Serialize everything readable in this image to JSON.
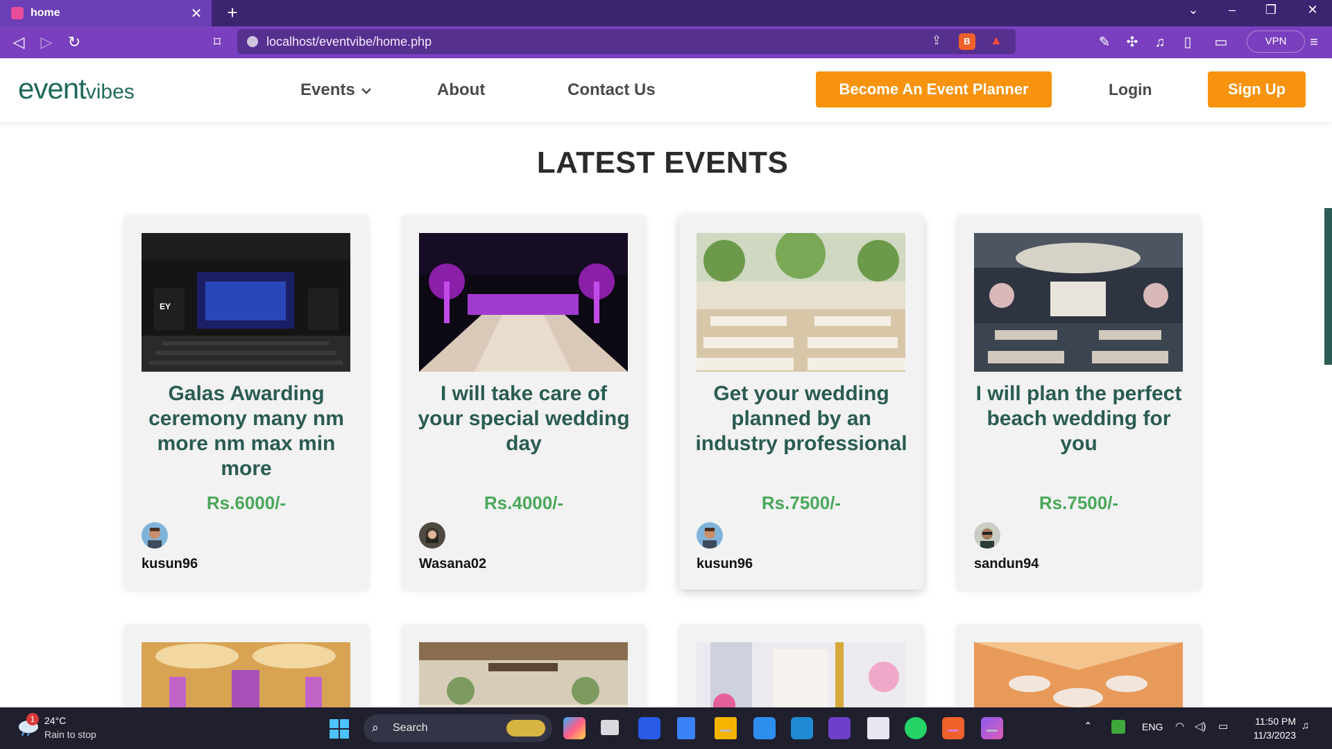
{
  "browser": {
    "tab_title": "home",
    "url": "localhost/eventvibe/home.php",
    "vpn_label": "VPN"
  },
  "site": {
    "logo_main": "event",
    "logo_suffix": "vibes",
    "nav": {
      "events": "Events",
      "about": "About",
      "contact": "Contact Us"
    },
    "become_planner": "Become An Event Planner",
    "login": "Login",
    "signup": "Sign Up"
  },
  "main": {
    "section_title": "LATEST EVENTS",
    "cards": [
      {
        "title": "Galas Awarding ceremony many nm more nm max min more",
        "price": "Rs.6000/-",
        "username": "kusun96"
      },
      {
        "title": "I will take care of your special wedding day",
        "price": "Rs.4000/-",
        "username": "Wasana02"
      },
      {
        "title": "Get your wedding planned by an industry professional",
        "price": "Rs.7500/-",
        "username": "kusun96"
      },
      {
        "title": "I will plan the perfect beach wedding for you",
        "price": "Rs.7500/-",
        "username": "sandun94"
      }
    ]
  },
  "taskbar": {
    "weather_temp": "24°C",
    "weather_desc": "Rain to stop",
    "weather_badge": "1",
    "search_label": "Search",
    "lang": "ENG",
    "time": "11:50 PM",
    "date": "11/3/2023"
  },
  "colors": {
    "brand_orange": "#f7930f",
    "brand_green": "#1f6a5c",
    "price_green": "#4aa85a",
    "browser_purple": "#7a3fbe"
  }
}
